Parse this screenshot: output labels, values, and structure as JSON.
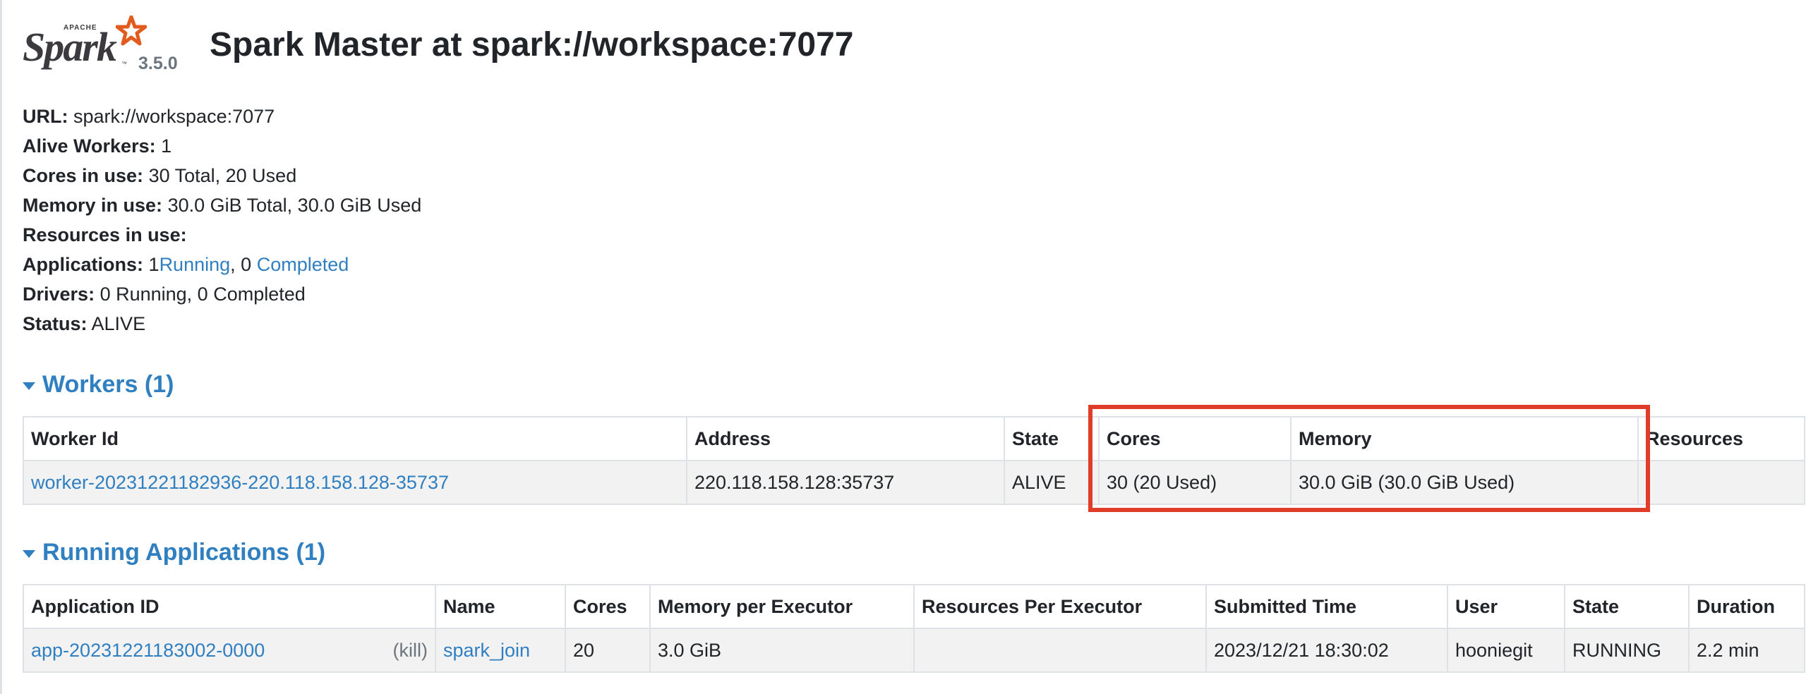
{
  "logo": {
    "apache": "APACHE",
    "spark": "Spark",
    "version": "3.5.0"
  },
  "page_title": "Spark Master at spark://workspace:7077",
  "summary": {
    "url_label": "URL:",
    "url_value": "spark://workspace:7077",
    "alive_workers_label": "Alive Workers:",
    "alive_workers_value": "1",
    "cores_label": "Cores in use:",
    "cores_value": "30 Total, 20 Used",
    "memory_label": "Memory in use:",
    "memory_value": "30.0 GiB Total, 30.0 GiB Used",
    "resources_label": "Resources in use:",
    "applications_label": "Applications:",
    "applications_running_count": "1",
    "applications_running_link": "Running",
    "applications_sep": ",",
    "applications_completed_count": "0",
    "applications_completed_link": "Completed",
    "drivers_label": "Drivers:",
    "drivers_value": "0 Running, 0 Completed",
    "status_label": "Status:",
    "status_value": "ALIVE"
  },
  "workers": {
    "title": "Workers (1)",
    "columns": [
      "Worker Id",
      "Address",
      "State",
      "Cores",
      "Memory",
      "Resources"
    ],
    "rows": [
      {
        "worker_id": "worker-20231221182936-220.118.158.128-35737",
        "address": "220.118.158.128:35737",
        "state": "ALIVE",
        "cores": "30 (20 Used)",
        "memory": "30.0 GiB (30.0 GiB Used)",
        "resources": ""
      }
    ]
  },
  "running_apps": {
    "title": "Running Applications (1)",
    "columns": [
      "Application ID",
      "Name",
      "Cores",
      "Memory per Executor",
      "Resources Per Executor",
      "Submitted Time",
      "User",
      "State",
      "Duration"
    ],
    "rows": [
      {
        "app_id": "app-20231221183002-0000",
        "kill": "(kill)",
        "name": "spark_join",
        "cores": "20",
        "memory_per_executor": "3.0 GiB",
        "resources_per_executor": "",
        "submitted_time": "2023/12/21 18:30:02",
        "user": "hooniegit",
        "state": "RUNNING",
        "duration": "2.2 min"
      }
    ]
  },
  "colors": {
    "link": "#2f7fc1",
    "highlight": "#e03c2a",
    "row_bg": "#f2f2f2",
    "logo_star": "#e25a1c"
  }
}
